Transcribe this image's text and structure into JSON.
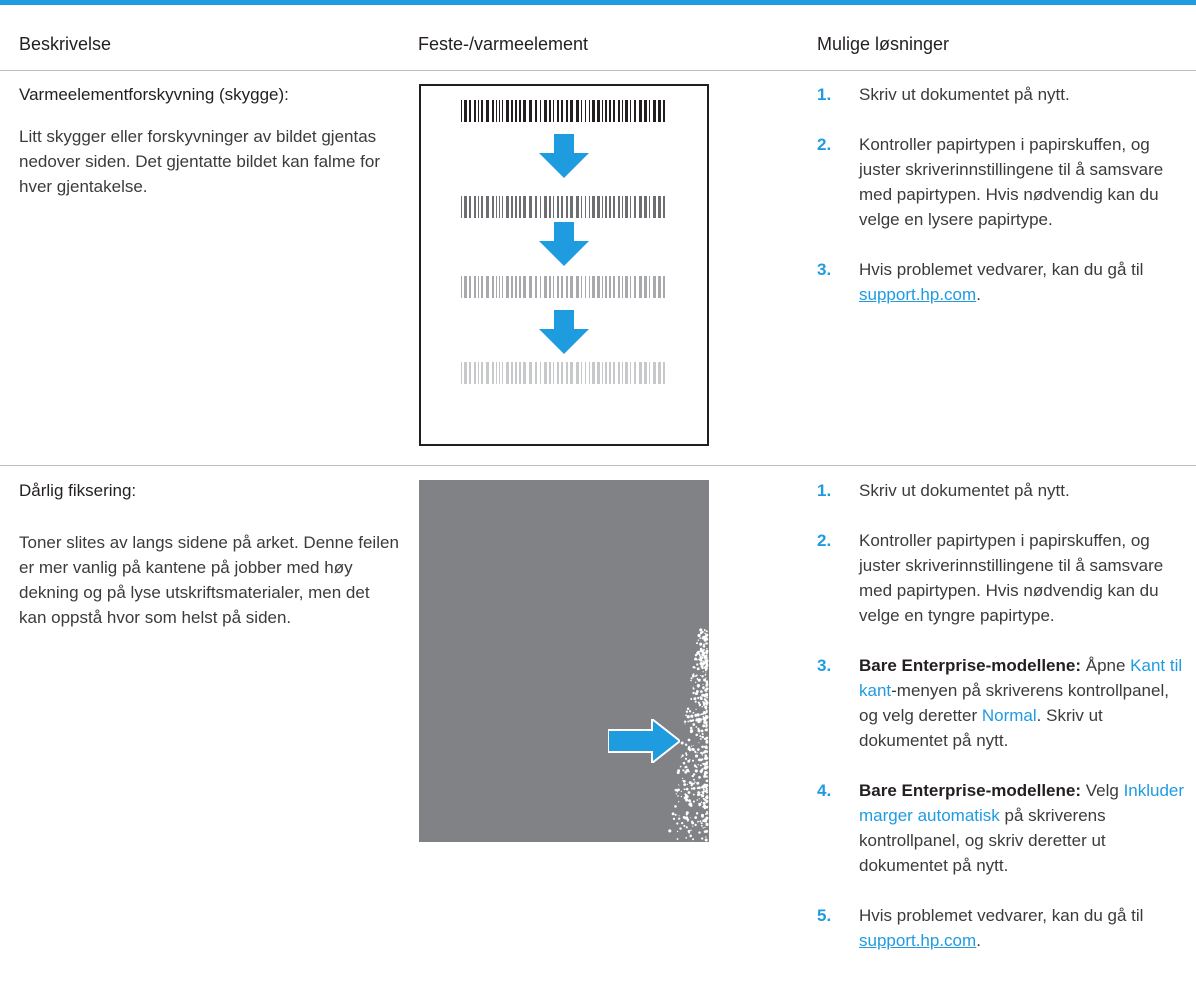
{
  "header": {
    "col_description": "Beskrivelse",
    "col_fuser": "Feste-/varmeelement",
    "col_solutions": "Mulige løsninger"
  },
  "colors": {
    "accent": "#1f9be0",
    "gray_page": "#808285"
  },
  "rows": [
    {
      "title": "Varmeelementforskyvning (skygge):",
      "description": "Litt skygger eller forskyvninger av bildet gjentas nedover siden. Det gjentatte bildet kan falme for hver gjentakelse.",
      "image": "barcode-repeat-arrows-illustration",
      "solutions": [
        {
          "num": "1.",
          "text": "Skriv ut dokumentet på nytt."
        },
        {
          "num": "2.",
          "text": "Kontroller papirtypen i papirskuffen, og juster skriverinnstillingene til å samsvare med papirtypen. Hvis nødvendig kan du velge en lysere papirtype."
        },
        {
          "num": "3.",
          "text_before": "Hvis problemet vedvarer, kan du gå til ",
          "link": "support.hp.com",
          "text_after": "."
        }
      ]
    },
    {
      "title": "Dårlig fiksering:",
      "description": "Toner slites av langs sidene på arket. Denne feilen er mer vanlig på kantene på jobber med høy dekning og på lyse utskriftsmaterialer, men det kan oppstå hvor som helst på siden.",
      "image": "gray-page-speckled-edge-illustration",
      "solutions": [
        {
          "num": "1.",
          "text": "Skriv ut dokumentet på nytt."
        },
        {
          "num": "2.",
          "text": "Kontroller papirtypen i papirskuffen, og juster skriverinnstillingene til å samsvare med papirtypen. Hvis nødvendig kan du velge en tyngre papirtype."
        },
        {
          "num": "3.",
          "bold": "Bare Enterprise-modellene:",
          "t1": " Åpne ",
          "link1": "Kant til kant",
          "t2": "-menyen på skriverens kontrollpanel, og velg deretter ",
          "link2": "Normal",
          "t3": ". Skriv ut dokumentet på nytt."
        },
        {
          "num": "4.",
          "bold": "Bare Enterprise-modellene:",
          "t1": " Velg ",
          "link1": "Inkluder marger automatisk",
          "t2": " på skriverens kontrollpanel, og skriv deretter ut dokumentet på nytt."
        },
        {
          "num": "5.",
          "text_before": "Hvis problemet vedvarer, kan du gå til ",
          "link": "support.hp.com",
          "text_after": "."
        }
      ]
    }
  ]
}
